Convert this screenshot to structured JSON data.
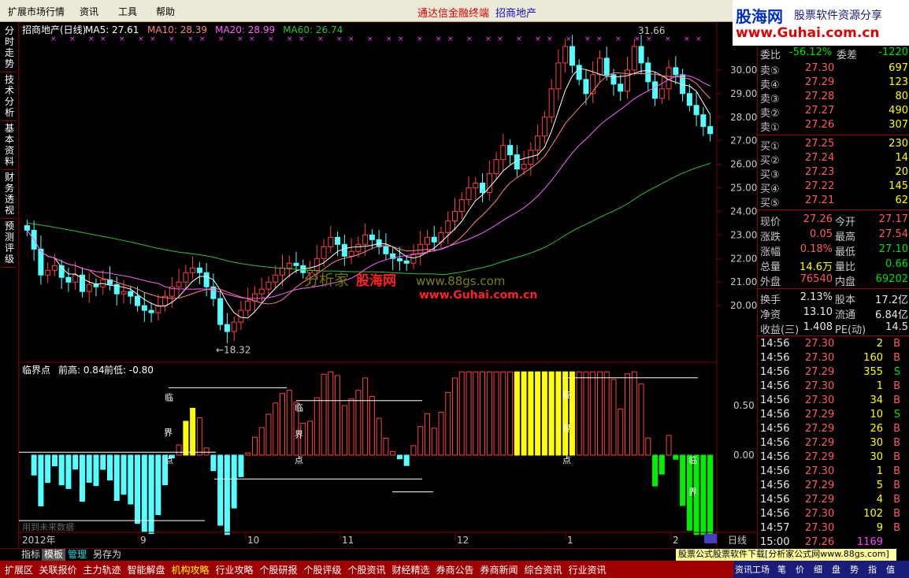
{
  "menu": [
    "扩展市场行情",
    "资讯",
    "工具",
    "帮助"
  ],
  "promo": {
    "a": "通达信金融终端",
    "b": "招商地产"
  },
  "logo": {
    "l1": "股海网",
    "l2": "股票软件资源分享",
    "l3": "www.Guhai.com.cn"
  },
  "left_tabs": [
    "分时走势",
    "技术分析",
    "基本资料",
    "财务透视",
    "预测评级"
  ],
  "kline": {
    "title": "招商地产(日线)",
    "ma": [
      {
        "label": "MA5: 27.61",
        "color": "#ffffff"
      },
      {
        "label": "MA10: 28.39",
        "color": "#ff8080"
      },
      {
        "label": "MA20: 28.99",
        "color": "#ff60ff"
      },
      {
        "label": "MA60: 26.74",
        "color": "#30c030"
      }
    ],
    "y_ticks": [
      30.0,
      29.0,
      28.0,
      27.0,
      26.0,
      25.0,
      24.0,
      23.0,
      22.0,
      21.0,
      20.0
    ],
    "high_label": "31.66",
    "low_label": "←18.32",
    "watermark1": "分析家",
    "watermark2": "股海网",
    "watermark3": "www.88gs.com",
    "watermark4": "www.Guhai.com.cn",
    "closes": [
      23.2,
      22.4,
      21.3,
      21.5,
      21.7,
      21.2,
      21.0,
      21.3,
      20.6,
      20.9,
      20.8,
      21.1,
      20.9,
      20.5,
      20.6,
      20.4,
      20.0,
      19.8,
      19.7,
      20.0,
      20.4,
      20.8,
      21.0,
      21.4,
      21.6,
      21.4,
      20.8,
      20.3,
      19.2,
      18.9,
      19.3,
      19.8,
      20.2,
      20.5,
      20.7,
      21.0,
      21.3,
      21.6,
      21.8,
      21.7,
      21.4,
      21.5,
      22.0,
      22.5,
      22.9,
      22.6,
      22.1,
      22.3,
      22.6,
      23.0,
      22.8,
      22.5,
      22.2,
      22.0,
      21.9,
      21.8,
      22.2,
      22.6,
      22.9,
      22.7,
      23.1,
      23.6,
      24.0,
      24.5,
      25.0,
      25.2,
      24.8,
      25.6,
      26.2,
      26.8,
      26.4,
      25.8,
      26.0,
      26.6,
      27.2,
      28.0,
      29.2,
      30.3,
      31.0,
      30.2,
      29.6,
      29.0,
      29.8,
      30.5,
      29.8,
      29.4,
      29.1,
      30.0,
      31.0,
      30.3,
      29.5,
      28.8,
      29.2,
      30.1,
      29.8,
      29.0,
      28.5,
      28.1,
      27.6,
      27.3
    ]
  },
  "osc": {
    "name": "临界点",
    "prev_high": "前高: 0.84",
    "prev_low": "前低: -0.80",
    "y_ticks": [
      "0.50",
      "0.00"
    ],
    "label_lin": "临",
    "label_jie": "界",
    "label_dian": "点",
    "future_note": "用到未来数据",
    "x_labels": [
      "2012年",
      "9",
      "10",
      "11",
      "12",
      "1",
      "2"
    ],
    "period": "日线"
  },
  "quote": {
    "weibi_label": "委比",
    "weibi": "-56.12%",
    "weicha_label": "委差",
    "weicha": "-1220",
    "asks": [
      {
        "l": "卖⑤",
        "p": "27.30",
        "v": "697"
      },
      {
        "l": "卖④",
        "p": "27.29",
        "v": "123"
      },
      {
        "l": "卖③",
        "p": "27.28",
        "v": "80"
      },
      {
        "l": "卖②",
        "p": "27.27",
        "v": "490"
      },
      {
        "l": "卖①",
        "p": "27.26",
        "v": "307"
      }
    ],
    "bids": [
      {
        "l": "买①",
        "p": "27.25",
        "v": "230"
      },
      {
        "l": "买②",
        "p": "27.24",
        "v": "14"
      },
      {
        "l": "买③",
        "p": "27.23",
        "v": "20"
      },
      {
        "l": "买④",
        "p": "27.22",
        "v": "145"
      },
      {
        "l": "买⑤",
        "p": "27.21",
        "v": "62"
      }
    ],
    "stats": [
      [
        {
          "l": "现价",
          "v": "27.26",
          "c": "red"
        },
        {
          "l": "今开",
          "v": "27.17",
          "c": "red"
        }
      ],
      [
        {
          "l": "涨跌",
          "v": "0.05",
          "c": "red"
        },
        {
          "l": "最高",
          "v": "27.54",
          "c": "red"
        }
      ],
      [
        {
          "l": "涨幅",
          "v": "0.18%",
          "c": "red"
        },
        {
          "l": "最低",
          "v": "27.10",
          "c": "grn"
        }
      ],
      [
        {
          "l": "总量",
          "v": "14.6万",
          "c": "yel"
        },
        {
          "l": "量比",
          "v": "0.66",
          "c": "grn"
        }
      ],
      [
        {
          "l": "外盘",
          "v": "76540",
          "c": "red"
        },
        {
          "l": "内盘",
          "v": "69202",
          "c": "grn"
        }
      ]
    ],
    "stats2": [
      [
        {
          "l": "换手",
          "v": "2.13%",
          "c": "wht"
        },
        {
          "l": "股本",
          "v": "17.2亿",
          "c": "wht"
        }
      ],
      [
        {
          "l": "净资",
          "v": "13.10",
          "c": "wht"
        },
        {
          "l": "流通",
          "v": "6.84亿",
          "c": "wht"
        }
      ],
      [
        {
          "l": "收益(三)",
          "v": "1.408",
          "c": "wht"
        },
        {
          "l": "PE(动)",
          "v": "14.5",
          "c": "wht"
        }
      ]
    ],
    "ticks": [
      {
        "t": "14:56",
        "p": "27.30",
        "v": "2",
        "s": "B"
      },
      {
        "t": "14:56",
        "p": "27.30",
        "v": "160",
        "s": "B"
      },
      {
        "t": "14:56",
        "p": "27.29",
        "v": "355",
        "s": "S"
      },
      {
        "t": "14:56",
        "p": "27.30",
        "v": "1",
        "s": "B"
      },
      {
        "t": "14:56",
        "p": "27.30",
        "v": "34",
        "s": "B"
      },
      {
        "t": "14:56",
        "p": "27.29",
        "v": "10",
        "s": "S"
      },
      {
        "t": "14:56",
        "p": "27.29",
        "v": "26",
        "s": "B"
      },
      {
        "t": "14:56",
        "p": "27.29",
        "v": "30",
        "s": "B"
      },
      {
        "t": "14:56",
        "p": "27.29",
        "v": "30",
        "s": "B"
      },
      {
        "t": "14:56",
        "p": "27.30",
        "v": "1",
        "s": "B"
      },
      {
        "t": "14:56",
        "p": "27.29",
        "v": "5",
        "s": "B"
      },
      {
        "t": "14:56",
        "p": "27.29",
        "v": "4",
        "s": "B"
      },
      {
        "t": "14:56",
        "p": "27.30",
        "v": "102",
        "s": "B"
      },
      {
        "t": "14:57",
        "p": "27.30",
        "v": "9",
        "s": "B"
      },
      {
        "t": "15:00",
        "p": "27.26",
        "v": "1169",
        "s": ""
      }
    ]
  },
  "bottom_tabs": [
    "指标",
    "模板",
    "管理",
    "另存为"
  ],
  "status": [
    "扩展区",
    "关联报价",
    "主力轨迹",
    "智能解盘",
    "机构攻略",
    "行业攻略",
    "个股研报",
    "个股评级",
    "个股资讯",
    "财经精选",
    "券商公告",
    "券商新闻",
    "综合资讯",
    "行业资讯"
  ],
  "download_banner": "股票公式股票软件下载[分析家公式网www.88gs.com]",
  "right_bottom": [
    "资讯工场",
    "笔",
    "价",
    "细",
    "盘",
    "势",
    "指",
    "值"
  ]
}
